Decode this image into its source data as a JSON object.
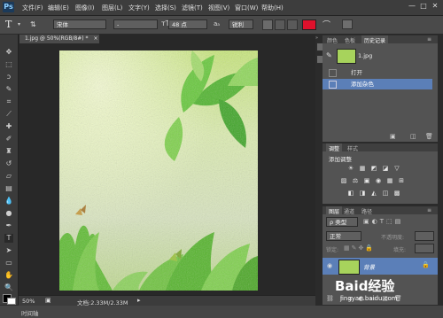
{
  "app": {
    "logo": "Ps"
  },
  "menu": [
    "文件(F)",
    "编辑(E)",
    "图像(I)",
    "图层(L)",
    "文字(Y)",
    "选择(S)",
    "滤镜(T)",
    "视图(V)",
    "窗口(W)",
    "帮助(H)"
  ],
  "window_controls": [
    "—",
    "□",
    "✕"
  ],
  "options": {
    "tool_glyph": "T",
    "font_family": "宋体",
    "font_style": "-",
    "font_size": "48 点",
    "aa_label": "aₐ",
    "aa_mode": "锐利",
    "color_swatch": "#e0112c"
  },
  "document": {
    "tab_label": "1.jpg @ 50%(RGB/8#) *",
    "tab_close": "×",
    "zoom": "50%",
    "doc_info": "文档:2.33M/2.33M"
  },
  "bottom": {
    "label": "时间轴"
  },
  "history_panel": {
    "tabs": [
      "颜色",
      "色板",
      "历史记录"
    ],
    "active_tab": "历史记录",
    "snapshot": "1.jpg",
    "items": [
      "打开",
      "添加杂色"
    ]
  },
  "adjust_panel": {
    "tabs": [
      "调整",
      "样式"
    ],
    "title": "添加调整",
    "row1": [
      "☀",
      "▦",
      "◩",
      "◪",
      "▽"
    ],
    "row2": [
      "▨",
      "⚖",
      "▣",
      "◉",
      "▦",
      "⊞"
    ],
    "row3": [
      "◧",
      "◨",
      "◭",
      "◫",
      "▩"
    ]
  },
  "layers_panel": {
    "tabs": [
      "图层",
      "通道",
      "路径"
    ],
    "filter_label": "ρ 类型",
    "blend_mode": "正常",
    "opacity_label": "不透明度:",
    "lock_label": "锁定:",
    "fill_label": "填充:",
    "layer_name": "背景",
    "eye": "👁",
    "lock_icon": "🔒"
  },
  "watermark": {
    "brand": "Baid经验",
    "url": "jingyan.baidu.com"
  },
  "colors": {
    "accent_selected": "#5b7fb8",
    "canvas_green": "#b8dd66"
  }
}
